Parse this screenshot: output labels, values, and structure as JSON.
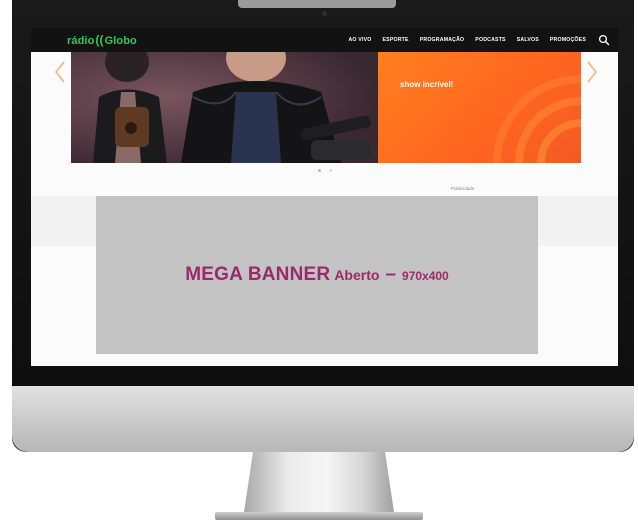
{
  "site": {
    "logo_prefix": "rádio",
    "logo_waves": "((",
    "logo_name": "Globo",
    "nav": [
      "AO VIVO",
      "ESPORTE",
      "PROGRAMAÇÃO",
      "PODCASTS",
      "SALVOS",
      "PROMOÇÕES"
    ]
  },
  "carousel": {
    "promo_text": "show incrível!",
    "active_slide": 1,
    "slide_count": 2
  },
  "ad": {
    "label": "Publicidade"
  },
  "banner": {
    "title": "MEGA BANNER",
    "subtitle": "Aberto",
    "dash": "–",
    "size": "970x400"
  },
  "colors": {
    "brand_green": "#33c759",
    "navbar_bg": "#121212",
    "promo_orange": "#ff6a20",
    "banner_bg": "#c3c3c3",
    "banner_text": "#9a2a6a"
  },
  "icons": {
    "search": "search-icon",
    "prev": "chevron-left-icon",
    "next": "chevron-right-icon"
  }
}
